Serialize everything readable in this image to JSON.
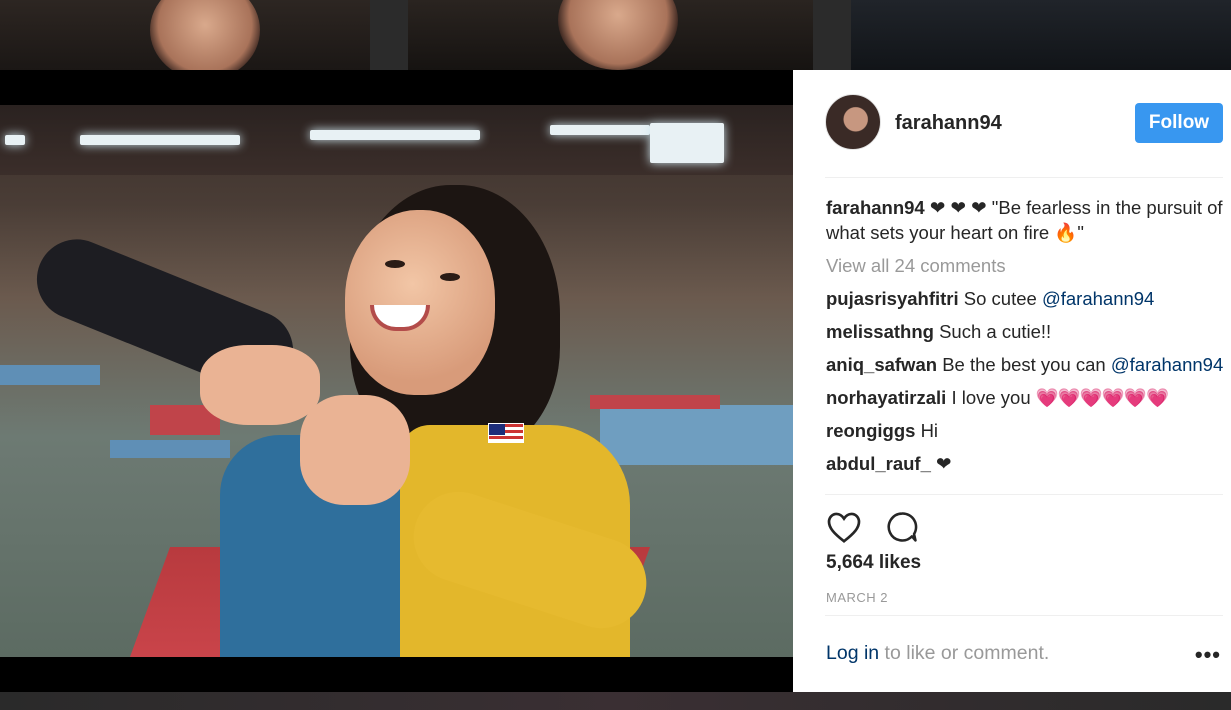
{
  "post": {
    "username": "farahann94",
    "follow_label": "Follow"
  },
  "caption": {
    "username": "farahann94",
    "text": "❤ ❤ ❤ \"Be fearless in the pursuit of what sets your heart on fire 🔥\""
  },
  "view_all": "View all 24 comments",
  "comments": [
    {
      "username": "pujasrisyahfitri",
      "text": "So cutee ",
      "mention": "@farahann94"
    },
    {
      "username": "melissathng",
      "text": "Such a cutie!!",
      "mention": ""
    },
    {
      "username": "aniq_safwan",
      "text": "Be the best you can ",
      "mention": "@farahann94"
    },
    {
      "username": "norhayatirzali",
      "text": "I love you ",
      "mention": "",
      "hearts": "💗💗💗💗💗💗"
    },
    {
      "username": "reongiggs",
      "text": "Hi",
      "mention": ""
    },
    {
      "username": "abdul_rauf_",
      "text": "❤",
      "mention": ""
    }
  ],
  "likes": "5,664 likes",
  "date": "MARCH 2",
  "login": {
    "link": "Log in",
    "text": " to like or comment."
  },
  "more_label": "•••",
  "icons": {
    "like": "heart-icon",
    "comment": "comment-bubble-icon",
    "more": "more-options-icon"
  },
  "colors": {
    "follow_button": "#3897f0",
    "mention": "#003569",
    "muted": "#999999"
  }
}
